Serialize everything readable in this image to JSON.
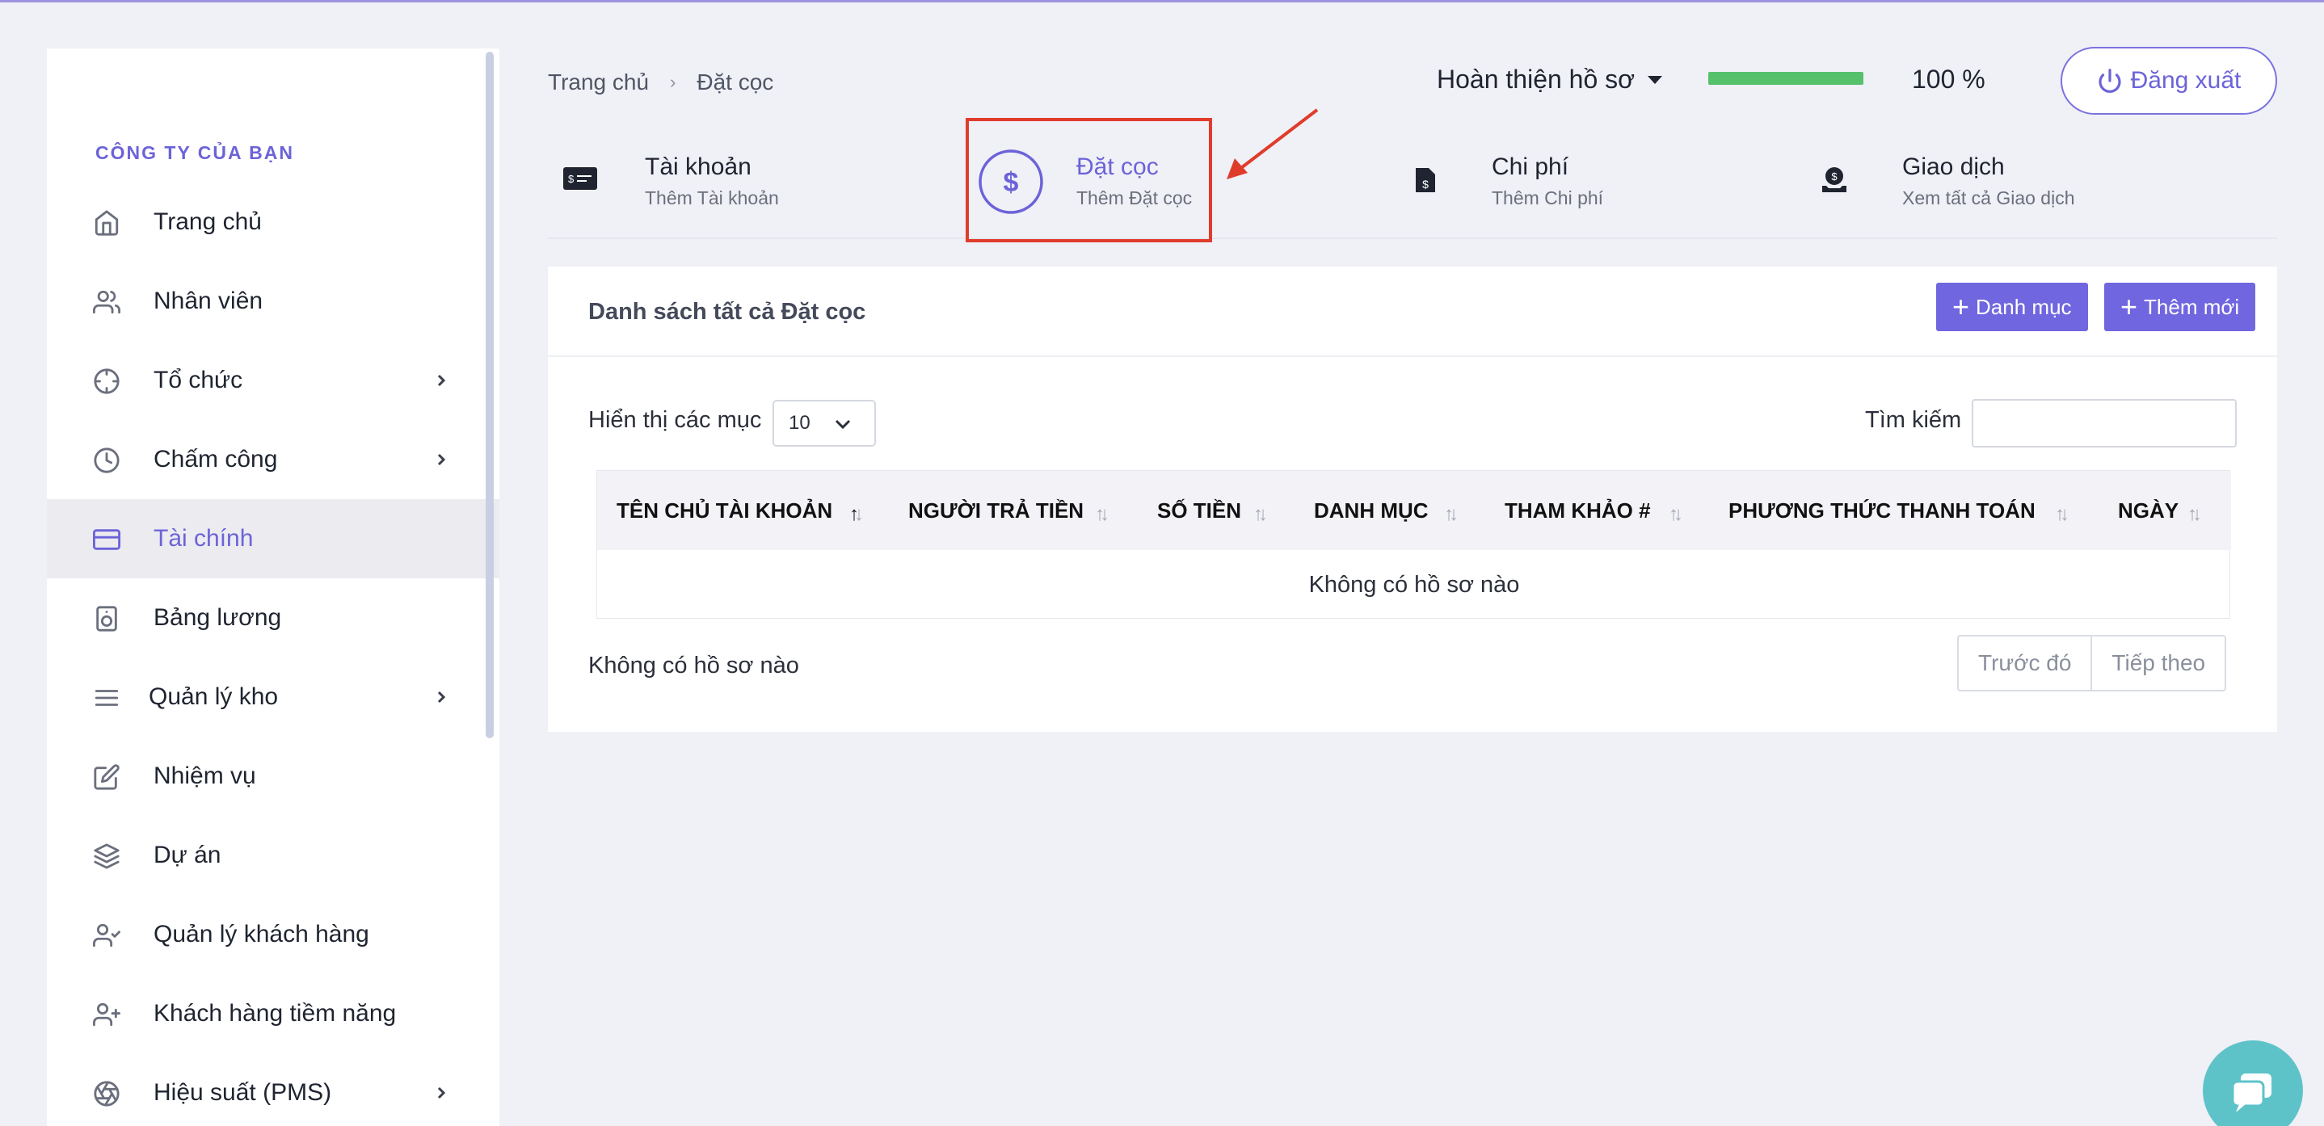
{
  "sidebar": {
    "company": "CÔNG TY CỦA BẠN",
    "items": [
      {
        "label": "Trang chủ",
        "icon": "home-icon"
      },
      {
        "label": "Nhân viên",
        "icon": "users-icon"
      },
      {
        "label": "Tổ chức",
        "icon": "crosshair-icon"
      },
      {
        "label": "Chấm công",
        "icon": "clock-icon"
      },
      {
        "label": "Tài chính",
        "icon": "credit-card-icon"
      },
      {
        "label": "Bảng lương",
        "icon": "speaker-icon"
      },
      {
        "label": "Quản lý kho",
        "icon": "menu-icon"
      },
      {
        "label": "Nhiệm vụ",
        "icon": "edit-icon"
      },
      {
        "label": "Dự án",
        "icon": "layers-icon"
      },
      {
        "label": "Quản lý khách hàng",
        "icon": "user-check-icon"
      },
      {
        "label": "Khách hàng tiềm năng",
        "icon": "user-plus-icon"
      },
      {
        "label": "Hiệu suất (PMS)",
        "icon": "aperture-icon"
      }
    ],
    "active": "Tài chính"
  },
  "breadcrumb": {
    "home": "Trang chủ",
    "current": "Đặt cọc"
  },
  "header": {
    "profile_label": "Hoàn thiện hồ sơ",
    "progress_percent": 100,
    "progress_text": "100 %",
    "logout_label": "Đăng xuất"
  },
  "quick_tabs": [
    {
      "title": "Tài khoản",
      "subtitle": "Thêm Tài khoản",
      "icon": "money-bill-icon"
    },
    {
      "title": "Đặt cọc",
      "subtitle": "Thêm Đặt cọc",
      "icon": "dollar-circle-icon"
    },
    {
      "title": "Chi phí",
      "subtitle": "Thêm Chi phí",
      "icon": "invoice-icon"
    },
    {
      "title": "Giao dịch",
      "subtitle": "Xem tất cả Giao dịch",
      "icon": "money-hand-icon"
    }
  ],
  "card": {
    "title": "Danh sách tất cả Đặt cọc",
    "category_button": "Danh mục",
    "add_button": "Thêm mới",
    "show_label": "Hiển thị các mục",
    "page_size": "10",
    "search_label": "Tìm kiếm",
    "search_value": "",
    "columns": [
      "TÊN CHỦ TÀI KHOẢN",
      "NGƯỜI TRẢ TIỀN",
      "SỐ TIỀN",
      "DANH MỤC",
      "THAM KHẢO #",
      "PHƯƠNG THỨC THANH TOÁN",
      "NGÀY"
    ],
    "empty_text": "Không có hồ sơ nào",
    "info_text": "Không có hồ sơ nào",
    "prev_label": "Trước đó",
    "next_label": "Tiếp theo"
  },
  "colors": {
    "accent": "#6c63d8",
    "button": "#7066e0",
    "progress": "#55c16a",
    "highlight": "#e03c2b",
    "chat": "#5ec3c9"
  }
}
